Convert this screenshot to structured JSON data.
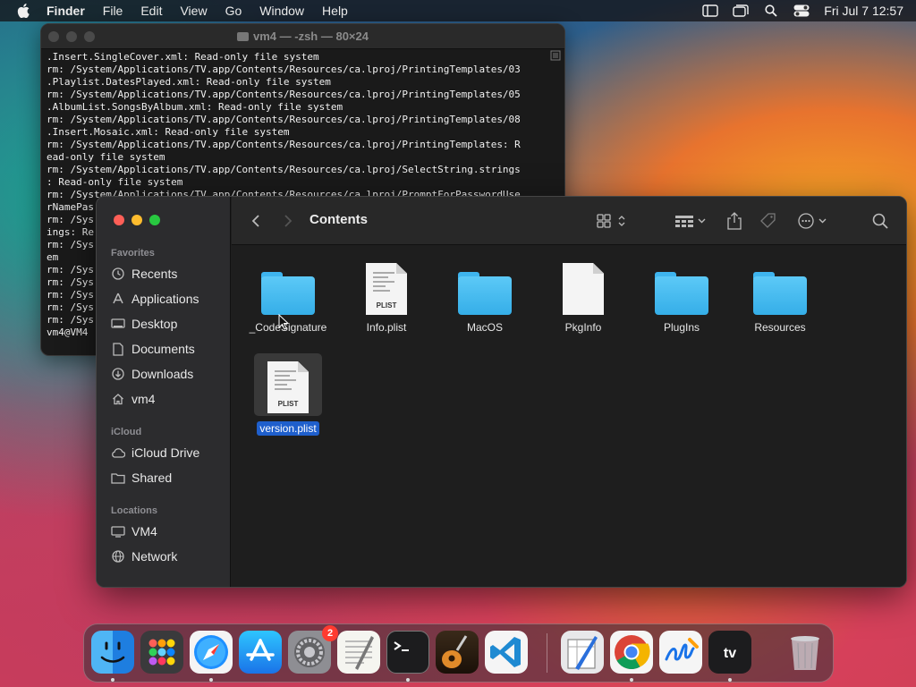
{
  "menubar": {
    "app_name": "Finder",
    "items": [
      "File",
      "Edit",
      "View",
      "Go",
      "Window",
      "Help"
    ],
    "clock": "Fri Jul 7  12:57"
  },
  "terminal": {
    "title": "vm4 — -zsh — 80×24",
    "lines": [
      ".Insert.SingleCover.xml: Read-only file system",
      "rm: /System/Applications/TV.app/Contents/Resources/ca.lproj/PrintingTemplates/03",
      ".Playlist.DatesPlayed.xml: Read-only file system",
      "rm: /System/Applications/TV.app/Contents/Resources/ca.lproj/PrintingTemplates/05",
      ".AlbumList.SongsByAlbum.xml: Read-only file system",
      "rm: /System/Applications/TV.app/Contents/Resources/ca.lproj/PrintingTemplates/08",
      ".Insert.Mosaic.xml: Read-only file system",
      "rm: /System/Applications/TV.app/Contents/Resources/ca.lproj/PrintingTemplates: R",
      "ead-only file system",
      "rm: /System/Applications/TV.app/Contents/Resources/ca.lproj/SelectString.strings",
      ": Read-only file system",
      "rm: /System/Applications/TV.app/Contents/Resources/ca.lproj/PromptForPasswordUse",
      "rNamePas",
      "rm: /Sys",
      "ings: Re",
      "rm: /Sys",
      "em",
      "rm: /Sys",
      "rm: /Sys",
      "rm: /Sys",
      "rm: /Sys",
      "rm: /Sys",
      "vm4@VM4 "
    ]
  },
  "finder": {
    "title": "Contents",
    "sidebar": {
      "favorites_label": "Favorites",
      "favorites": [
        {
          "label": "Recents",
          "icon": "clock-icon"
        },
        {
          "label": "Applications",
          "icon": "applications-icon"
        },
        {
          "label": "Desktop",
          "icon": "desktop-icon"
        },
        {
          "label": "Documents",
          "icon": "document-icon"
        },
        {
          "label": "Downloads",
          "icon": "download-icon"
        },
        {
          "label": "vm4",
          "icon": "home-icon"
        }
      ],
      "icloud_label": "iCloud",
      "icloud": [
        {
          "label": "iCloud Drive",
          "icon": "cloud-icon"
        },
        {
          "label": "Shared",
          "icon": "shared-folder-icon"
        }
      ],
      "locations_label": "Locations",
      "locations": [
        {
          "label": "VM4",
          "icon": "computer-icon"
        },
        {
          "label": "Network",
          "icon": "globe-icon"
        }
      ]
    },
    "files": [
      {
        "name": "_CodeSignature",
        "kind": "folder"
      },
      {
        "name": "Info.plist",
        "kind": "plist"
      },
      {
        "name": "MacOS",
        "kind": "folder"
      },
      {
        "name": "PkgInfo",
        "kind": "blank"
      },
      {
        "name": "PlugIns",
        "kind": "folder"
      },
      {
        "name": "Resources",
        "kind": "folder"
      },
      {
        "name": "version.plist",
        "kind": "plist",
        "selected": true
      }
    ],
    "plist_tag": "PLIST"
  },
  "dock": {
    "apps": [
      "finder",
      "launchpad",
      "safari",
      "app-store",
      "system-settings",
      "textedit",
      "terminal",
      "garageband",
      "vscode",
      "preview",
      "chrome",
      "freeform",
      "apple-tv",
      "trash"
    ],
    "settings_badge": "2"
  }
}
